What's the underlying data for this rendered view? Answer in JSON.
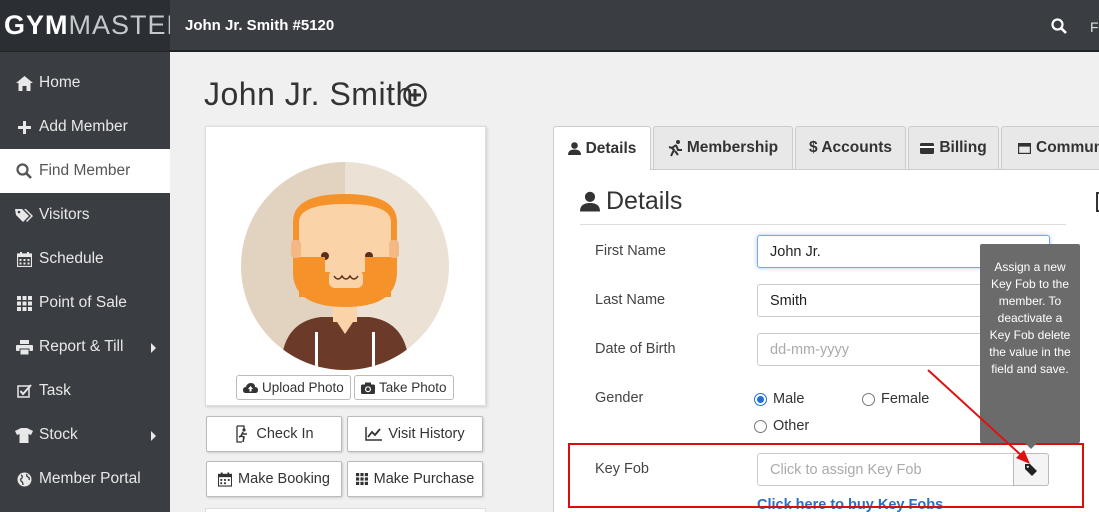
{
  "logo": {
    "gym": "GYM",
    "master": "MASTER"
  },
  "topbar": {
    "title": "John Jr. Smith #5120",
    "truncated_right": "Fr"
  },
  "sidebar": {
    "items": [
      {
        "label": "Home",
        "icon": "home-icon"
      },
      {
        "label": "Add Member",
        "icon": "plus-icon"
      },
      {
        "label": "Find Member",
        "icon": "search-icon",
        "active": true
      },
      {
        "label": "Visitors",
        "icon": "tags-icon"
      },
      {
        "label": "Schedule",
        "icon": "calendar-icon"
      },
      {
        "label": "Point of Sale",
        "icon": "grid-icon"
      },
      {
        "label": "Report & Till",
        "icon": "print-icon",
        "submenu": true
      },
      {
        "label": "Task",
        "icon": "checkbox-icon"
      },
      {
        "label": "Stock",
        "icon": "tshirt-icon",
        "submenu": true
      },
      {
        "label": "Member Portal",
        "icon": "globe-icon"
      }
    ]
  },
  "member": {
    "name": "John Jr. Smith"
  },
  "photo": {
    "upload_label": "Upload Photo",
    "take_label": "Take Photo"
  },
  "actions": {
    "check_in": "Check In",
    "visit_history": "Visit History",
    "make_booking": "Make Booking",
    "make_purchase": "Make Purchase"
  },
  "tabs": [
    {
      "label": "Details",
      "active": true
    },
    {
      "label": "Membership"
    },
    {
      "label": "$ Accounts"
    },
    {
      "label": "Billing"
    },
    {
      "label": "Commun"
    }
  ],
  "details": {
    "heading": "Details",
    "first_name_label": "First Name",
    "first_name_value": "John Jr.",
    "last_name_label": "Last Name",
    "last_name_value": "Smith",
    "dob_label": "Date of Birth",
    "dob_placeholder": "dd-mm-yyyy",
    "gender_label": "Gender",
    "gender_options": [
      "Male",
      "Female",
      "Other"
    ],
    "gender_selected": "Male",
    "keyfob_label": "Key Fob",
    "keyfob_placeholder": "Click to assign Key Fob",
    "keyfob_link": "Click here to buy Key Fobs"
  },
  "tooltip": {
    "text": "Assign a new Key Fob to the member. To deactivate a Key Fob delete the value in the field and save."
  },
  "colors": {
    "sidebar": "#3a3d41",
    "highlight": "#d80f0f",
    "link": "#2a6fc0",
    "avatar_beard": "#f6922a",
    "radio": "#1f6fd6"
  }
}
